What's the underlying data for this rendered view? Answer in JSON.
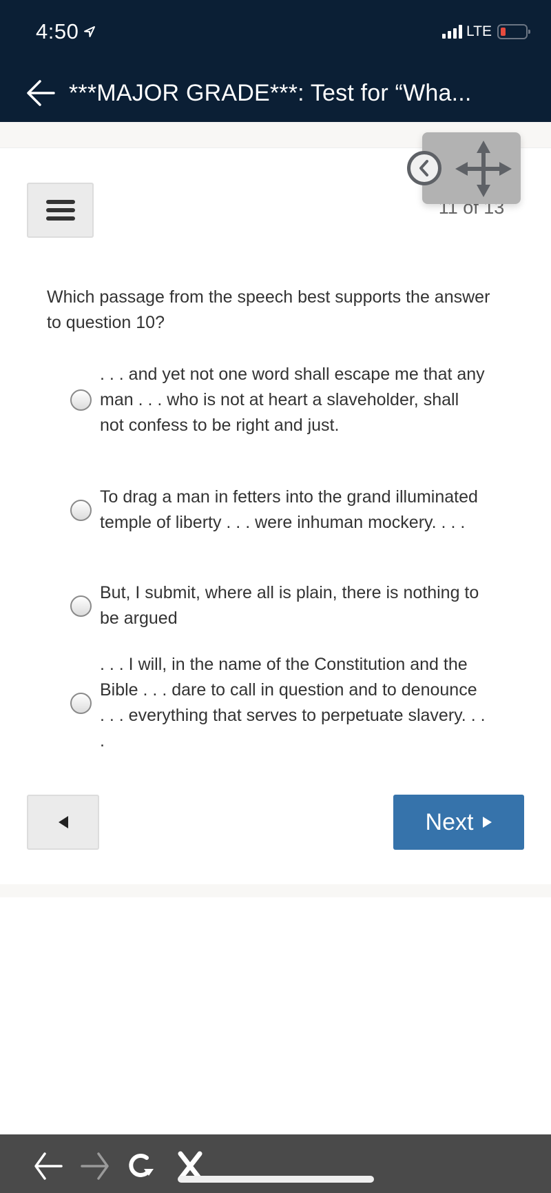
{
  "status_bar": {
    "time": "4:50",
    "network": "LTE",
    "battery_level": 0.1,
    "colors": {
      "battery_low": "#e54b3e"
    }
  },
  "header": {
    "title": "***MAJOR GRADE***: Test for “Wha...",
    "back_icon": "arrow-left-icon",
    "background": "#0b1f35"
  },
  "quiz": {
    "menu_icon": "hamburger-menu-icon",
    "page_counter": "11 of 13",
    "current_page": 11,
    "total_pages": 13,
    "question": "Which passage from the speech best supports the answer to question 10?",
    "options": [
      {
        "text": ". . . and yet not one word shall escape me that any man . . . who is not at heart a slaveholder, shall not confess to be right and just.",
        "selected": false
      },
      {
        "text": "To drag a man in fetters into the grand illuminated temple of liberty . . . were inhuman mockery. . . .",
        "selected": false
      },
      {
        "text": "But, I submit, where all is plain, there is nothing to be argued",
        "selected": false
      },
      {
        "text": ". . . I will, in the name of the Constitution and the Bible . . . dare to call in question and to denounce . . . everything that serves to perpetuate slavery. . . .",
        "selected": false
      }
    ],
    "prev_button_icon": "triangle-left-icon",
    "next_button_label": "Next",
    "next_button_icon": "triangle-right-icon",
    "colors": {
      "next_button": "#3673ab"
    }
  },
  "floating_widget": {
    "collapse_icon": "chevron-left-circle-icon",
    "move_icon": "move-arrows-icon"
  },
  "browser_toolbar": {
    "buttons": [
      {
        "name": "back",
        "icon": "arrow-left-icon",
        "enabled": true
      },
      {
        "name": "forward",
        "icon": "arrow-right-icon",
        "enabled": false
      },
      {
        "name": "reload",
        "icon": "reload-icon",
        "enabled": true
      },
      {
        "name": "close",
        "icon": "close-icon",
        "enabled": true
      }
    ]
  }
}
